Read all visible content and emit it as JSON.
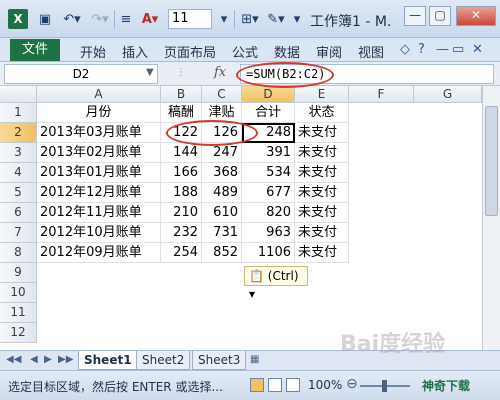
{
  "app": {
    "title": "工作簿1 - M.",
    "font_size": "11"
  },
  "ribbon": {
    "tabs": [
      "文件",
      "开始",
      "插入",
      "页面布局",
      "公式",
      "数据",
      "审阅",
      "视图"
    ]
  },
  "formula_bar": {
    "name_box": "D2",
    "fx_label": "fx",
    "formula": "=SUM(B2:C2)"
  },
  "grid": {
    "columns": [
      "A",
      "B",
      "C",
      "D",
      "E",
      "F",
      "G"
    ],
    "rows": [
      "1",
      "2",
      "3",
      "4",
      "5",
      "6",
      "7",
      "8",
      "9",
      "10",
      "11",
      "12"
    ],
    "header_row": [
      "月份",
      "稿酬",
      "津贴",
      "合计",
      "状态"
    ],
    "data": [
      [
        "2013年03月账单",
        "122",
        "126",
        "248",
        "未支付"
      ],
      [
        "2013年02月账单",
        "144",
        "247",
        "391",
        "未支付"
      ],
      [
        "2013年01月账单",
        "166",
        "368",
        "534",
        "未支付"
      ],
      [
        "2012年12月账单",
        "188",
        "489",
        "677",
        "未支付"
      ],
      [
        "2012年11月账单",
        "210",
        "610",
        "820",
        "未支付"
      ],
      [
        "2012年10月账单",
        "232",
        "731",
        "963",
        "未支付"
      ],
      [
        "2012年09月账单",
        "254",
        "852",
        "1106",
        "未支付"
      ]
    ],
    "selected_cell": "D2",
    "paste_options": "(Ctrl)"
  },
  "sheets": [
    "Sheet1",
    "Sheet2",
    "Sheet3"
  ],
  "status_bar": {
    "message": "选定目标区域，然后按 ENTER 或选择...",
    "zoom": "100%"
  },
  "branding": {
    "watermark": "Bai度经验",
    "site": "神奇下载"
  },
  "colors": {
    "accent": "#1e7145",
    "annotation_ring": "#d23a2f",
    "active_header": "#f1c15f"
  }
}
